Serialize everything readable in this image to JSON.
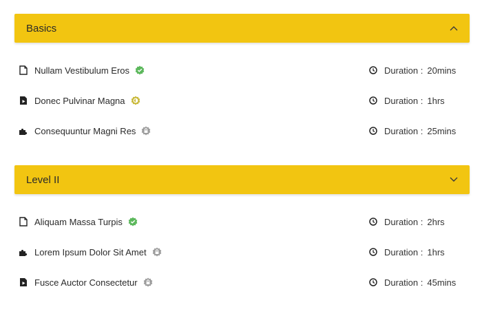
{
  "sections": [
    {
      "title": "Basics",
      "toggle_icon": "chevron-up-icon",
      "items": [
        {
          "title": "Nullam Vestibulum Eros",
          "type_icon": "document-icon",
          "status_icon": "check-badge-icon",
          "status_color": "#5cb85c",
          "duration_label": "Duration :",
          "duration_value": "20mins"
        },
        {
          "title": "Donec Pulvinar Magna",
          "type_icon": "video-file-icon",
          "status_icon": "half-complete-badge-icon",
          "status_color": "#c9b93a",
          "duration_label": "Duration :",
          "duration_value": "1hrs"
        },
        {
          "title": "Consequuntur Magni Res",
          "type_icon": "puzzle-icon",
          "status_icon": "locked-badge-icon",
          "status_color": "#9e9e9e",
          "duration_label": "Duration :",
          "duration_value": "25mins"
        }
      ]
    },
    {
      "title": "Level II",
      "toggle_icon": "chevron-down-icon",
      "items": [
        {
          "title": "Aliquam Massa Turpis",
          "type_icon": "document-icon",
          "status_icon": "check-badge-icon",
          "status_color": "#5cb85c",
          "duration_label": "Duration :",
          "duration_value": "2hrs"
        },
        {
          "title": "Lorem Ipsum Dolor Sit Amet",
          "type_icon": "puzzle-icon",
          "status_icon": "locked-badge-icon",
          "status_color": "#9e9e9e",
          "duration_label": "Duration :",
          "duration_value": "1hrs"
        },
        {
          "title": "Fusce Auctor Consectetur",
          "type_icon": "video-file-icon",
          "status_icon": "locked-badge-icon",
          "status_color": "#9e9e9e",
          "duration_label": "Duration :",
          "duration_value": "45mins"
        }
      ]
    }
  ],
  "colors": {
    "accent": "#f2c511",
    "complete": "#5cb85c",
    "partial": "#c9b93a",
    "locked": "#9e9e9e"
  }
}
